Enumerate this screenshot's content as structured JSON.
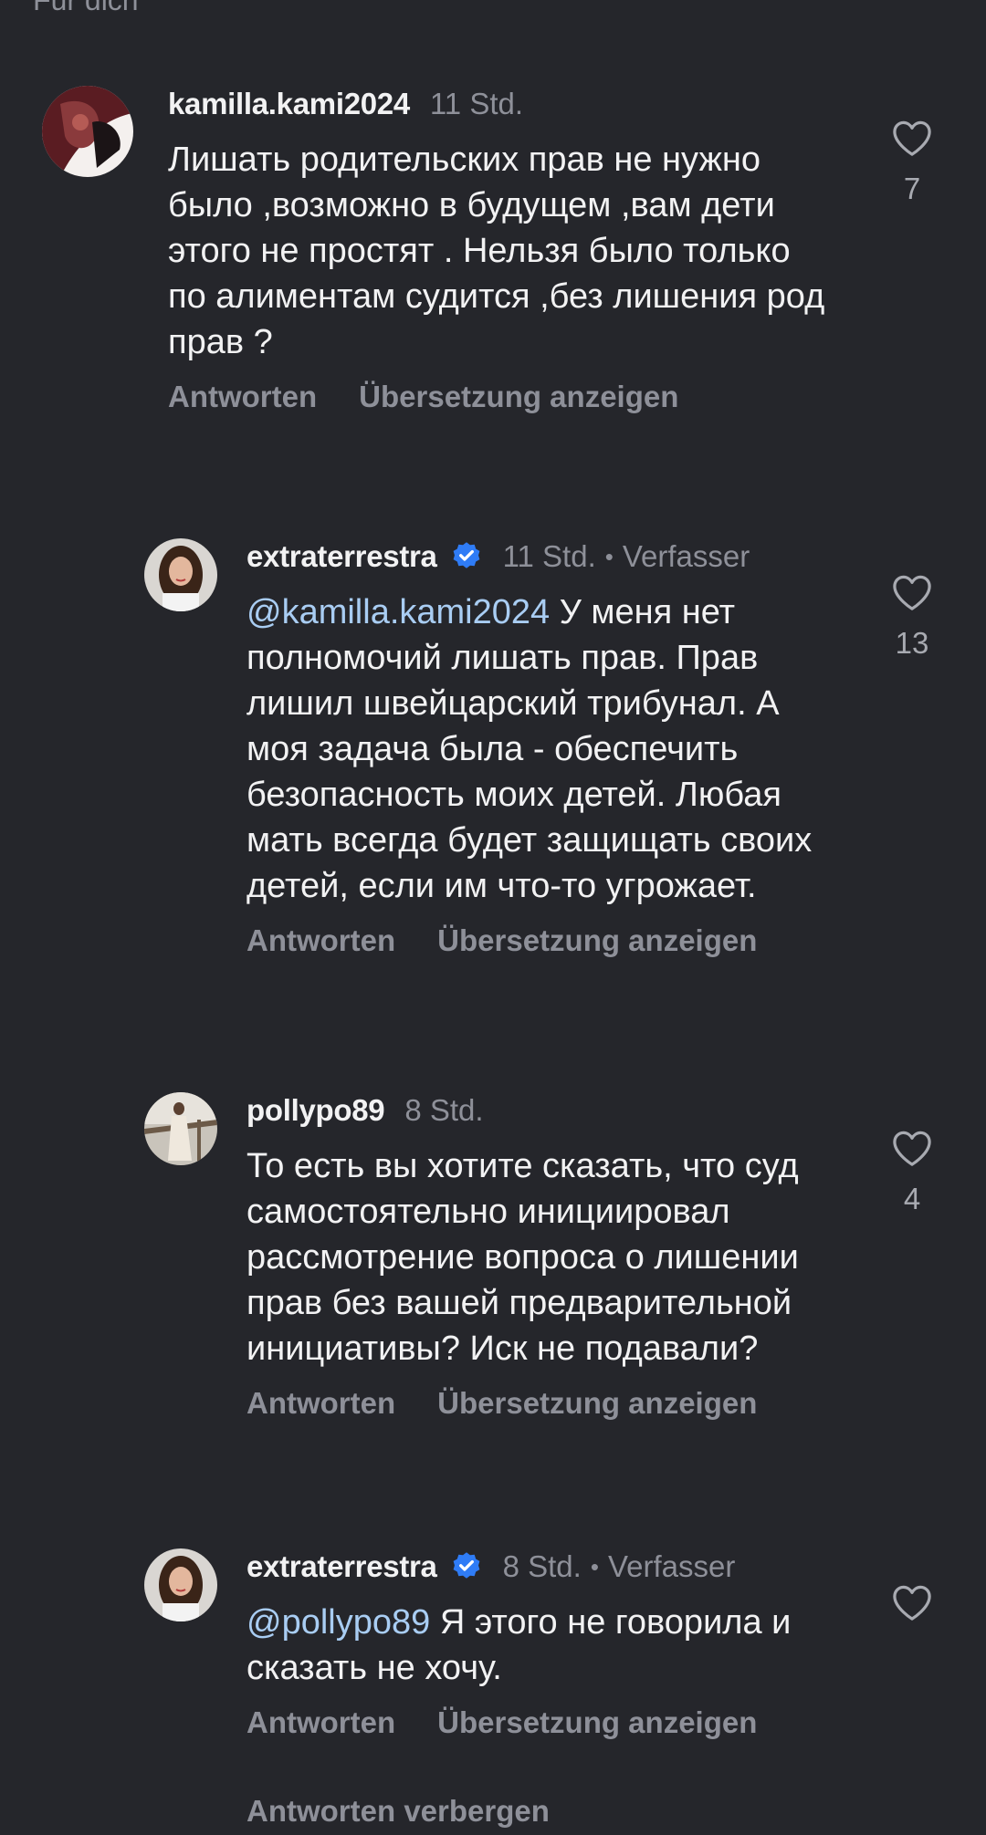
{
  "header": {
    "partial_text": "Für dich"
  },
  "comments": [
    {
      "username": "kamilla.kami2024",
      "time": "11 Std.",
      "author_tag": "",
      "mention": "",
      "text": "Лишать родительских прав не нужно было ,возможно в будущем ,вам дети этого не простят . Нельзя было только по алиментам судится ,без лишения род прав ?",
      "likes": "7",
      "reply_label": "Antworten",
      "translate_label": "Übersetzung anzeigen"
    },
    {
      "username": "extraterrestra",
      "time": "11 Std.",
      "author_tag": "Verfasser",
      "mention": "@kamilla.kami2024",
      "text": " У меня нет полномочий лишать прав. Прав лишил швейцарский трибунал. А моя задача была - обеспечить безопасность моих детей. Любая мать всегда будет защищать своих детей, если им что-то угрожает.",
      "likes": "13",
      "reply_label": "Antworten",
      "translate_label": "Übersetzung anzeigen"
    },
    {
      "username": "pollypo89",
      "time": "8 Std.",
      "author_tag": "",
      "mention": "",
      "text": "То есть вы хотите сказать, что суд самостоятельно инициировал рассмотрение вопроса о лишении прав без вашей предварительной инициативы? Иск не подавали?",
      "likes": "4",
      "reply_label": "Antworten",
      "translate_label": "Übersetzung anzeigen"
    },
    {
      "username": "extraterrestra",
      "time": "8 Std.",
      "author_tag": "Verfasser",
      "mention": "@pollypo89",
      "text": " Я этого не говорила и сказать не хочу.",
      "likes": "",
      "reply_label": "Antworten",
      "translate_label": "Übersetzung anzeigen"
    }
  ],
  "footer": {
    "hide_replies_label": "Antworten verbergen"
  },
  "colors": {
    "background": "#25262b",
    "text": "#f2f2f3",
    "muted": "#8e9099",
    "mention": "#a9cdf3",
    "verified": "#2f7cf6"
  },
  "icons": {
    "like": "heart-outline-icon",
    "verified": "verified-badge-icon"
  }
}
